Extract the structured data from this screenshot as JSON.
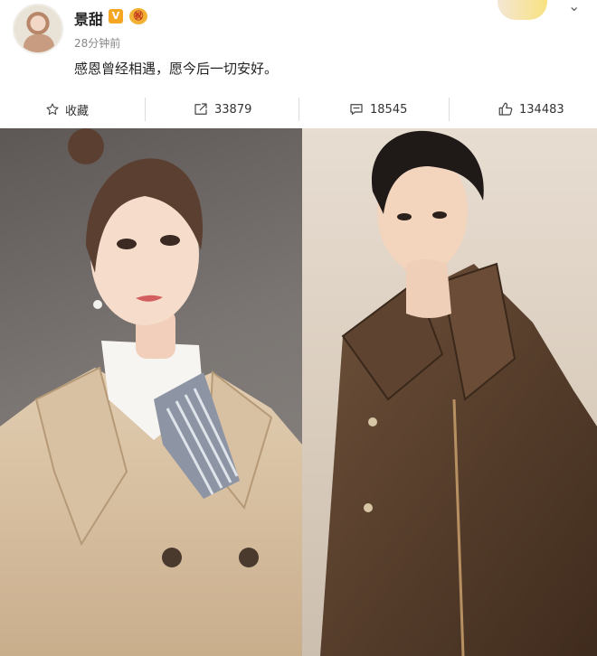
{
  "post": {
    "username": "景甜",
    "verified_mark": "V",
    "vip_mark": "㊗",
    "timestamp": "28分钟前",
    "text": "感恩曾经相遇，愿今后一切安好。"
  },
  "actions": {
    "favorite_label": "收藏",
    "repost_count": "33879",
    "comment_count": "18545",
    "like_count": "134483"
  },
  "icons": [
    "star-icon",
    "repost-icon",
    "comment-icon",
    "like-icon",
    "more-icon"
  ],
  "colors": {
    "verified_badge": "#f5a623",
    "left_photo_background": "#6f6a67",
    "right_photo_background": "#ded2c5",
    "trench_coat": "#d6bea0",
    "jacket": "#5b3f2a"
  }
}
